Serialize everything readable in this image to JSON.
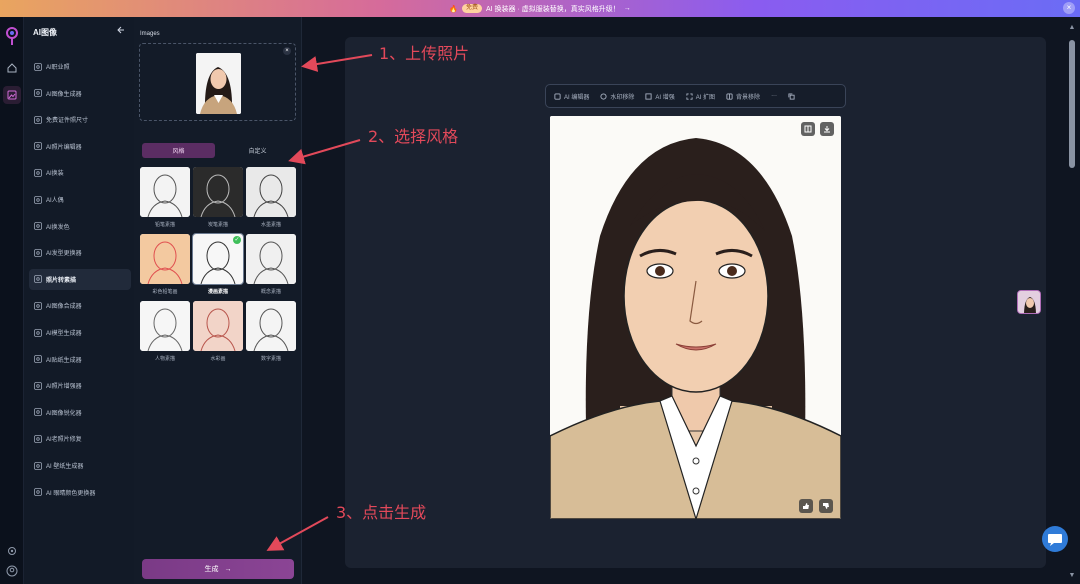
{
  "banner": {
    "fire_icon": "fire-icon",
    "badge": "免费",
    "text": "AI 换装器 · 虚拟服装替换，真实风格升级！",
    "arrow": "→",
    "close": "×"
  },
  "nav": {
    "title": "AI图像",
    "items": [
      {
        "label": "AI职业照",
        "icon": "portrait-icon"
      },
      {
        "label": "AI图像生成器",
        "icon": "image-icon"
      },
      {
        "label": "免费证件照尺寸",
        "icon": "idcard-icon"
      },
      {
        "label": "AI照片编辑器",
        "icon": "edit-icon"
      },
      {
        "label": "AI换装",
        "icon": "shirt-icon"
      },
      {
        "label": "AI人偶",
        "icon": "figure-icon"
      },
      {
        "label": "AI换发色",
        "icon": "brush-icon"
      },
      {
        "label": "AI发型更换器",
        "icon": "hair-icon"
      },
      {
        "label": "照片转素描",
        "icon": "sketch-icon",
        "active": true
      },
      {
        "label": "AI图像合成器",
        "icon": "merge-icon"
      },
      {
        "label": "AI模型生成器",
        "icon": "model-icon"
      },
      {
        "label": "AI贴纸生成器",
        "icon": "sticker-icon"
      },
      {
        "label": "AI照片增强器",
        "icon": "enhance-icon"
      },
      {
        "label": "AI图像锐化器",
        "icon": "sharpen-icon"
      },
      {
        "label": "AI老照片修复",
        "icon": "restore-icon"
      },
      {
        "label": "AI 壁纸生成器",
        "icon": "wallpaper-icon"
      },
      {
        "label": "AI 眼睛颜色更换器",
        "icon": "eye-icon"
      }
    ]
  },
  "panel": {
    "images_label": "Images",
    "tabs": [
      "风格",
      "自定义"
    ],
    "styles": [
      {
        "label": "铅笔素描"
      },
      {
        "label": "炭笔素描"
      },
      {
        "label": "水墨素描"
      },
      {
        "label": "彩色铅笔画"
      },
      {
        "label": "漫画素描",
        "selected": true
      },
      {
        "label": "概念素描"
      },
      {
        "label": "人物素描"
      },
      {
        "label": "水彩画"
      },
      {
        "label": "数字素描"
      }
    ],
    "generate": "生成",
    "generate_arrow": "→"
  },
  "toolbar": {
    "tools": [
      {
        "label": "AI 编辑器",
        "icon": "ai-edit-icon"
      },
      {
        "label": "水印移除",
        "icon": "watermark-icon"
      },
      {
        "label": "AI 增强",
        "icon": "enhance-icon"
      },
      {
        "label": "AI 扩图",
        "icon": "expand-icon"
      },
      {
        "label": "背景移除",
        "icon": "bg-remove-icon"
      }
    ],
    "more": "···"
  },
  "annotations": {
    "step1": "1、上传照片",
    "step2": "2、选择风格",
    "step3": "3、点击生成"
  },
  "colors": {
    "accent": "#8b4595",
    "annotation": "#e2495a",
    "success": "#3fbf5a"
  }
}
